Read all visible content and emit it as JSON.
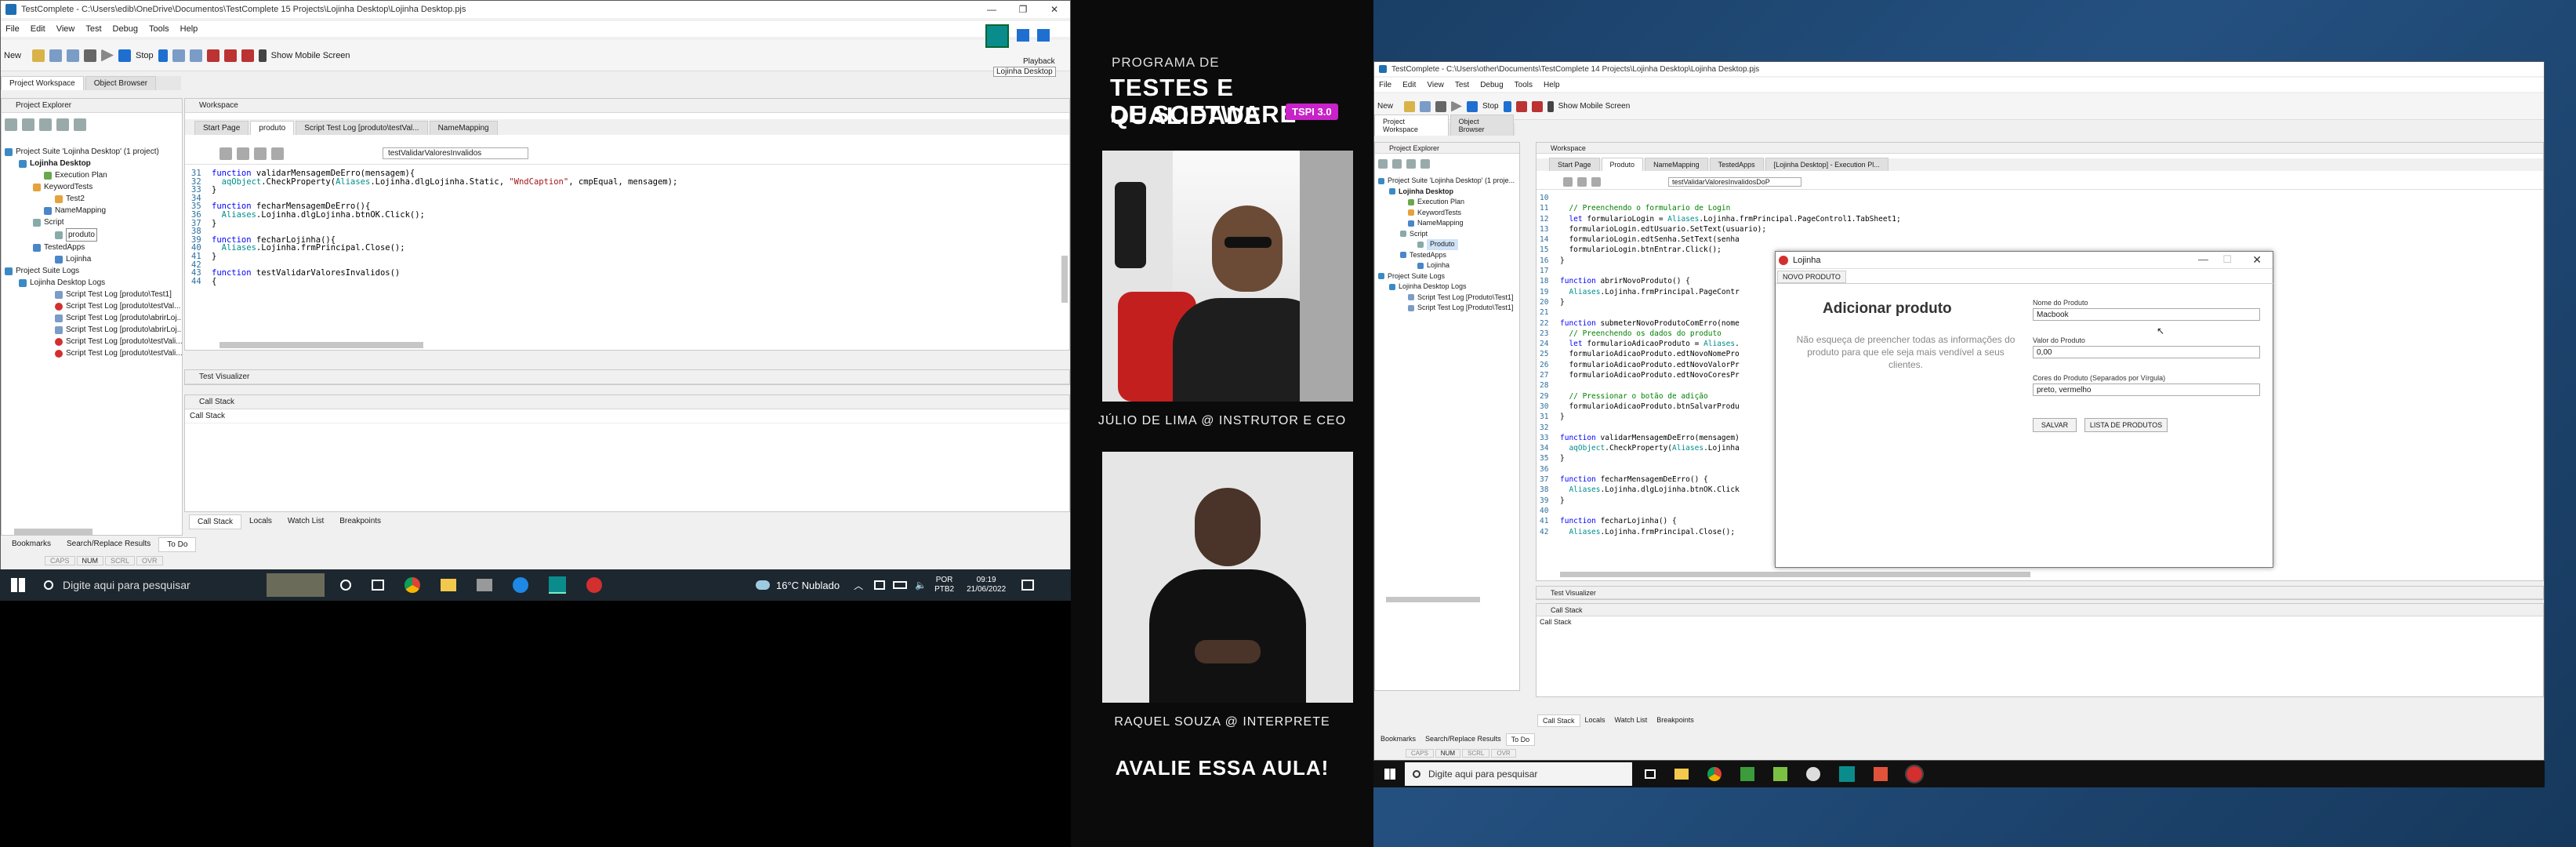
{
  "left": {
    "title": "TestComplete - C:\\Users\\edib\\OneDrive\\Documentos\\TestComplete 15 Projects\\Lojinha Desktop\\Lojinha Desktop.pjs",
    "menu": [
      "File",
      "Edit",
      "View",
      "Test",
      "Debug",
      "Tools",
      "Help"
    ],
    "toolbar": {
      "new": "New",
      "stop": "Stop",
      "mobile": "Show Mobile Screen"
    },
    "playback": {
      "label1": "Playback",
      "label2": "Lojinha Desktop"
    },
    "ws_tabs": [
      "Project Workspace",
      "Object Browser"
    ],
    "project_explorer": "Project Explorer",
    "tree": [
      "Project Suite 'Lojinha Desktop' (1 project)",
      "Lojinha Desktop",
      "Execution Plan",
      "KeywordTests",
      "Test2",
      "NameMapping",
      "Script",
      "produto",
      "TestedApps",
      "Lojinha",
      "Project Suite Logs",
      "Lojinha Desktop Logs",
      "Script Test Log [produto\\Test1]",
      "Script Test Log [produto\\testVal...",
      "Script Test Log [produto\\abrirLoj...",
      "Script Test Log [produto\\abrirLoj...",
      "Script Test Log [produto\\testVali...",
      "Script Test Log [produto\\testVali..."
    ],
    "workspace": "Workspace",
    "editor_tabs": [
      "Start Page",
      "produto",
      "Script Test Log [produto\\testVal...",
      "NameMapping"
    ],
    "routine": "testValidarValoresInvalidos",
    "code": [
      {
        "n": "31",
        "t": "function validarMensagemDeErro(mensagem){"
      },
      {
        "n": "32",
        "t": "  aqObject.CheckProperty(Aliases.Lojinha.dlgLojinha.Static, \"WndCaption\", cmpEqual, mensagem);"
      },
      {
        "n": "33",
        "t": "}"
      },
      {
        "n": "34",
        "t": ""
      },
      {
        "n": "35",
        "t": "function fecharMensagemDeErro(){"
      },
      {
        "n": "36",
        "t": "  Aliases.Lojinha.dlgLojinha.btnOK.Click();"
      },
      {
        "n": "37",
        "t": "}"
      },
      {
        "n": "38",
        "t": ""
      },
      {
        "n": "39",
        "t": "function fecharLojinha(){"
      },
      {
        "n": "40",
        "t": "  Aliases.Lojinha.frmPrincipal.Close();"
      },
      {
        "n": "41",
        "t": "}"
      },
      {
        "n": "42",
        "t": ""
      },
      {
        "n": "43",
        "t": "function testValidarValoresInvalidos()"
      },
      {
        "n": "44",
        "t": "{"
      }
    ],
    "test_visualizer": "Test Visualizer",
    "call_stack": "Call Stack",
    "call_stack_col": "Call Stack",
    "bottom_tabs": [
      "Call Stack",
      "Locals",
      "Watch List",
      "Breakpoints"
    ],
    "footer_tabs": [
      "Bookmarks",
      "Search/Replace Results",
      "To Do"
    ],
    "status": [
      "CAPS",
      "NUM",
      "SCRL",
      "OVR"
    ],
    "taskbar": {
      "search": "Digite aqui para pesquisar",
      "weather": "16°C  Nublado",
      "lang1": "POR",
      "lang2": "PTB2",
      "time": "09:19",
      "date": "21/06/2022"
    }
  },
  "center": {
    "program": "PROGRAMA DE",
    "title1": "TESTES E QUALIDADE",
    "title2": "DE SOFTWARE",
    "badge": "TSPI 3.0",
    "badge_color": "#c822c8",
    "instructor": "JÚLIO DE LIMA @ INSTRUTOR E CEO",
    "interpreter": "RAQUEL SOUZA @ INTERPRETE",
    "cta": "AVALIE ESSA AULA!"
  },
  "right": {
    "title": "TestComplete - C:\\Users\\other\\Documents\\TestComplete 14 Projects\\Lojinha Desktop\\Lojinha Desktop.pjs",
    "menu": [
      "File",
      "Edit",
      "View",
      "Test",
      "Debug",
      "Tools",
      "Help"
    ],
    "toolbar": {
      "new": "New",
      "stop": "Stop",
      "mobile": "Show Mobile Screen"
    },
    "ws_tabs": [
      "Project Workspace",
      "Object Browser"
    ],
    "project_explorer": "Project Explorer",
    "tree": [
      "Project Suite 'Lojinha Desktop' (1 proje...",
      "Lojinha Desktop",
      "Execution Plan",
      "KeywordTests",
      "NameMapping",
      "Script",
      "Produto",
      "TestedApps",
      "Lojinha",
      "Project Suite Logs",
      "Lojinha Desktop Logs",
      "Script Test Log [Produto\\Test1]",
      "Script Test Log [Produto\\Test1]"
    ],
    "workspace": "Workspace",
    "editor_tabs": [
      "Start Page",
      "Produto",
      "NameMapping",
      "TestedApps",
      "[Lojinha Desktop] - Execution Pl..."
    ],
    "routine": "testValidarValoresInvalidosDoP",
    "code": [
      {
        "n": "10",
        "t": ""
      },
      {
        "n": "11",
        "t": "  // Preenchendo o formulario de Login"
      },
      {
        "n": "12",
        "t": "  let formularioLogin = Aliases.Lojinha.frmPrincipal.PageControl1.TabSheet1;"
      },
      {
        "n": "13",
        "t": "  formularioLogin.edtUsuario.SetText(usuario);"
      },
      {
        "n": "14",
        "t": "  formularioLogin.edtSenha.SetText(senha"
      },
      {
        "n": "15",
        "t": "  formularioLogin.btnEntrar.Click();"
      },
      {
        "n": "16",
        "t": "}"
      },
      {
        "n": "17",
        "t": ""
      },
      {
        "n": "18",
        "t": "function abrirNovoProduto() {"
      },
      {
        "n": "19",
        "t": "  Aliases.Lojinha.frmPrincipal.PageContr"
      },
      {
        "n": "20",
        "t": "}"
      },
      {
        "n": "21",
        "t": ""
      },
      {
        "n": "22",
        "t": "function submeterNovoProdutoComErro(nome"
      },
      {
        "n": "23",
        "t": "  // Preenchendo os dados do produto"
      },
      {
        "n": "24",
        "t": "  let formularioAdicaoProduto = Aliases."
      },
      {
        "n": "25",
        "t": "  formularioAdicaoProduto.edtNovoNomePro"
      },
      {
        "n": "26",
        "t": "  formularioAdicaoProduto.edtNovoValorPr"
      },
      {
        "n": "27",
        "t": "  formularioAdicaoProduto.edtNovoCoresPr"
      },
      {
        "n": "28",
        "t": ""
      },
      {
        "n": "29",
        "t": "  // Pressionar o botão de adição"
      },
      {
        "n": "30",
        "t": "  formularioAdicaoProduto.btnSalvarProdu"
      },
      {
        "n": "31",
        "t": "}"
      },
      {
        "n": "32",
        "t": ""
      },
      {
        "n": "33",
        "t": "function validarMensagemDeErro(mensagem)"
      },
      {
        "n": "34",
        "t": "  aqObject.CheckProperty(Aliases.Lojinha"
      },
      {
        "n": "35",
        "t": "}"
      },
      {
        "n": "36",
        "t": ""
      },
      {
        "n": "37",
        "t": "function fecharMensagemDeErro() {"
      },
      {
        "n": "38",
        "t": "  Aliases.Lojinha.dlgLojinha.btnOK.Click"
      },
      {
        "n": "39",
        "t": "}"
      },
      {
        "n": "40",
        "t": ""
      },
      {
        "n": "41",
        "t": "function fecharLojinha() {"
      },
      {
        "n": "42",
        "t": "  Aliases.Lojinha.frmPrincipal.Close();"
      }
    ],
    "test_visualizer": "Test Visualizer",
    "call_stack": "Call Stack",
    "call_stack_col": "Call Stack",
    "bottom_tabs": [
      "Call Stack",
      "Locals",
      "Watch List",
      "Breakpoints"
    ],
    "footer_tabs": [
      "Bookmarks",
      "Search/Replace Results",
      "To Do"
    ],
    "status": [
      "CAPS",
      "NUM",
      "SCRL",
      "OVR"
    ],
    "taskbar": {
      "search": "Digite aqui para pesquisar"
    },
    "dialog": {
      "title": "Lojinha",
      "tab": "NOVO PRODUTO",
      "heading": "Adicionar produto",
      "hint": "Não esqueça de preencher todas as informações do produto para que ele seja mais vendível a seus clientes.",
      "name_label": "Nome do Produto",
      "name_value": "Macbook",
      "value_label": "Valor do Produto",
      "value_value": "0,00",
      "colors_label": "Cores do Produto (Separados por Vírgula)",
      "colors_value": "preto, vermelho",
      "save": "SALVAR",
      "list": "LISTA DE PRODUTOS"
    }
  }
}
